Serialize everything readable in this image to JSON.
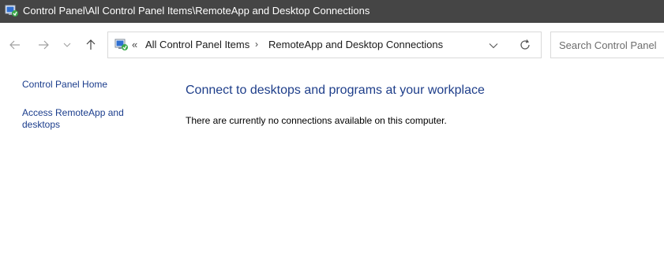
{
  "window": {
    "title": "Control Panel\\All Control Panel Items\\RemoteApp and Desktop Connections",
    "app_icon": "remoteapp-icon"
  },
  "nav": {
    "back_icon": "arrow-left-icon",
    "forward_icon": "arrow-right-icon",
    "recent_icon": "chevron-down-icon",
    "up_icon": "arrow-up-icon"
  },
  "address": {
    "overflow_label": "«",
    "crumbs": [
      "All Control Panel Items",
      "RemoteApp and Desktop Connections"
    ],
    "separator": "›",
    "dropdown_icon": "chevron-down-icon",
    "refresh_icon": "refresh-icon"
  },
  "search": {
    "placeholder": "Search Control Panel"
  },
  "sidebar": {
    "links": [
      "Control Panel Home",
      "Access RemoteApp and desktops"
    ]
  },
  "main": {
    "heading": "Connect to desktops and programs at your workplace",
    "message": "There are currently no connections available on this computer."
  },
  "colors": {
    "titlebar_bg": "#454545",
    "link": "#1a3c8c",
    "heading": "#1e3e8a"
  }
}
